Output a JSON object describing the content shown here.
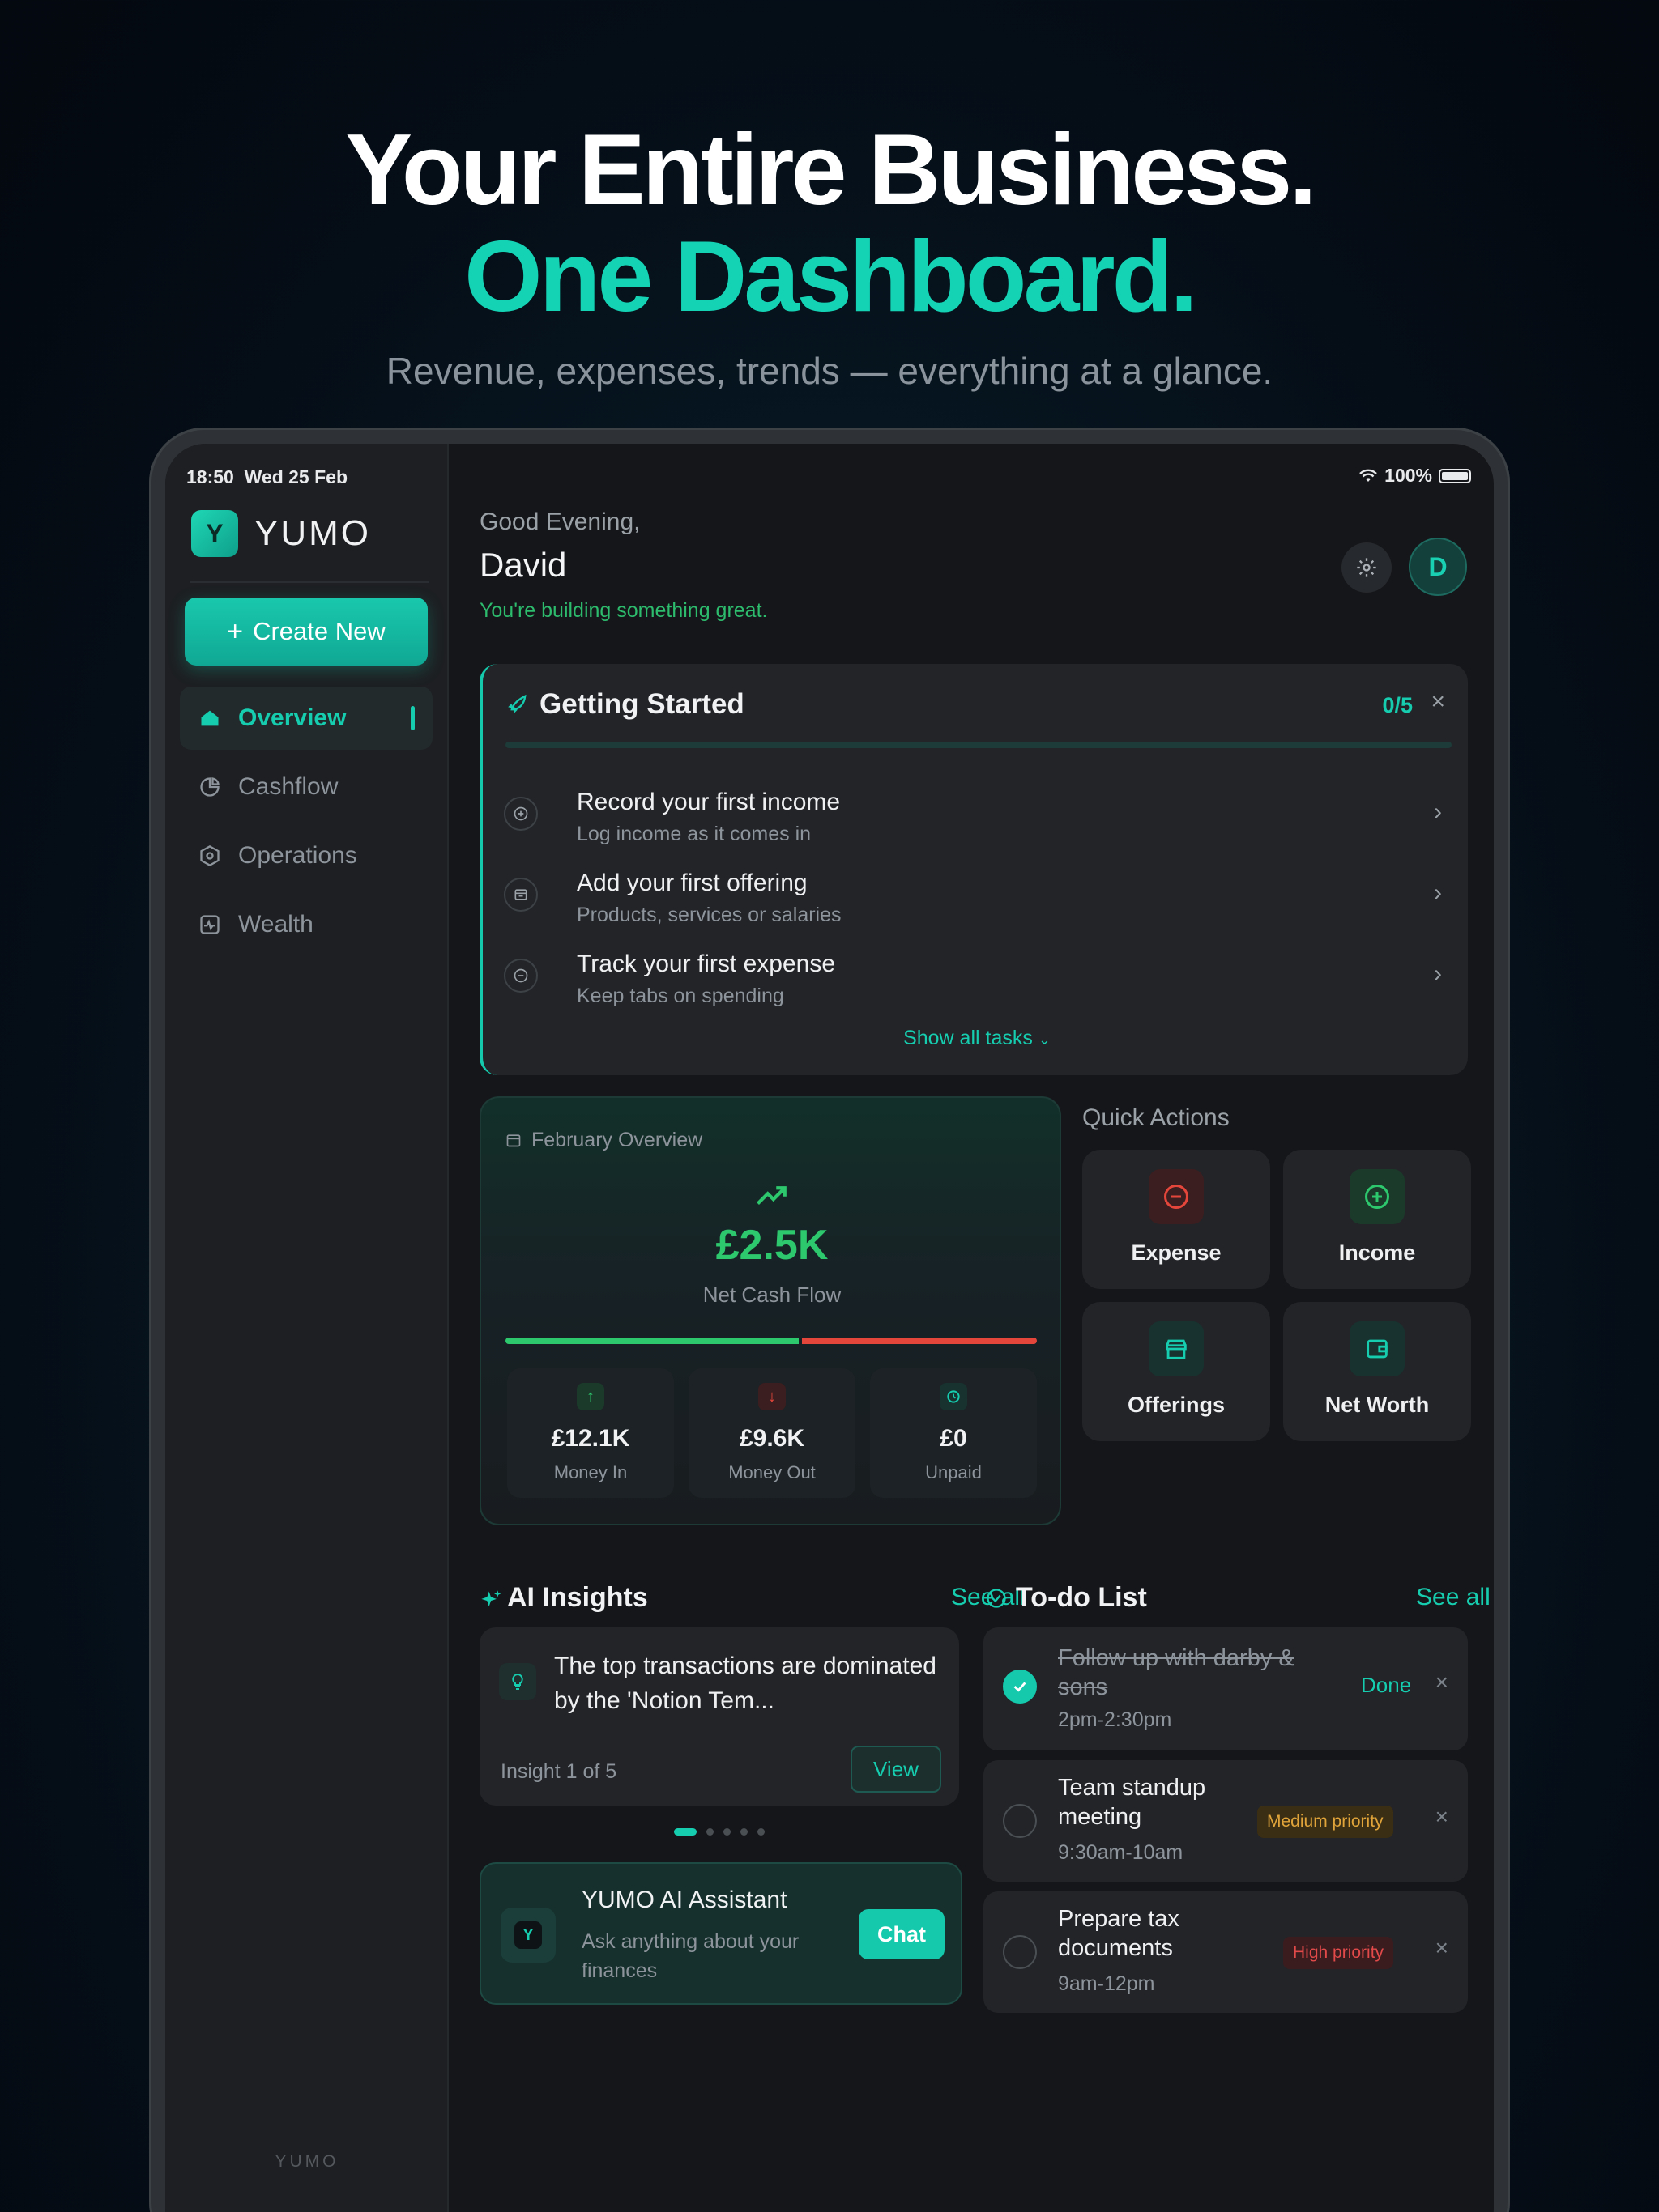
{
  "hero": {
    "line1": "Your Entire Business.",
    "line2": "One Dashboard.",
    "subtitle": "Revenue, expenses, trends — everything at a glance."
  },
  "status_bar": {
    "time": "18:50",
    "date": "Wed 25 Feb",
    "battery": "100%",
    "wifi_icon": "wifi-icon",
    "battery_icon": "battery-icon"
  },
  "sidebar": {
    "logo_letter": "Y",
    "brand": "YUMO",
    "create_button": "Create New",
    "items": [
      {
        "label": "Overview",
        "icon": "home-icon",
        "active": true
      },
      {
        "label": "Cashflow",
        "icon": "pie-chart-icon",
        "active": false
      },
      {
        "label": "Operations",
        "icon": "hexagon-icon",
        "active": false
      },
      {
        "label": "Wealth",
        "icon": "activity-icon",
        "active": false
      }
    ],
    "footer": "YUMO"
  },
  "header": {
    "greeting": "Good Evening,",
    "name": "David",
    "motto": "You're building something great.",
    "avatar_letter": "D"
  },
  "getting_started": {
    "title": "Getting Started",
    "progress": "0/5",
    "progress_fraction": 0,
    "tasks": [
      {
        "title": "Record your first income",
        "subtitle": "Log income as it comes in",
        "icon": "plus-circle-icon"
      },
      {
        "title": "Add your first offering",
        "subtitle": "Products, services or salaries",
        "icon": "store-icon"
      },
      {
        "title": "Track your first expense",
        "subtitle": "Keep tabs on spending",
        "icon": "minus-circle-icon"
      }
    ],
    "show_all": "Show all tasks"
  },
  "overview": {
    "label": "February Overview",
    "amount": "£2.5K",
    "amount_label": "Net Cash Flow",
    "stats": [
      {
        "value": "£12.1K",
        "label": "Money In",
        "icon": "arrow-up-icon",
        "color": "#2dc76d"
      },
      {
        "value": "£9.6K",
        "label": "Money Out",
        "icon": "arrow-down-icon",
        "color": "#e4463b"
      },
      {
        "value": "£0",
        "label": "Unpaid",
        "icon": "clock-icon",
        "color": "#16cdb0"
      }
    ]
  },
  "quick_actions": {
    "title": "Quick Actions",
    "items": [
      {
        "label": "Expense",
        "icon": "minus-circle-icon",
        "color": "#e4463b"
      },
      {
        "label": "Income",
        "icon": "plus-circle-icon",
        "color": "#2dc76d"
      },
      {
        "label": "Offerings",
        "icon": "store-icon",
        "color": "#16cdb0"
      },
      {
        "label": "Net Worth",
        "icon": "wallet-icon",
        "color": "#16cdb0"
      }
    ]
  },
  "ai_insights": {
    "title": "AI Insights",
    "see_all": "See all",
    "text": "The top transactions are dominated by the 'Notion Tem...",
    "counter": "Insight 1 of 5",
    "view": "View"
  },
  "assistant": {
    "logo_letter": "Y",
    "title": "YUMO AI Assistant",
    "subtitle": "Ask anything about your finances",
    "chat": "Chat"
  },
  "todo": {
    "title": "To-do List",
    "see_all": "See all",
    "items": [
      {
        "name": "Follow up with darby & sons",
        "time": "2pm-2:30pm",
        "status": "Done",
        "done": true
      },
      {
        "name": "Team standup meeting",
        "time": "9:30am-10am",
        "priority": "Medium priority",
        "done": false
      },
      {
        "name": "Prepare tax documents",
        "time": "9am-12pm",
        "priority": "High priority",
        "done": false
      }
    ]
  },
  "colors": {
    "accent": "#14d2b4",
    "positive": "#2dc76d",
    "negative": "#e4463b",
    "warning": "#e0a43a"
  }
}
